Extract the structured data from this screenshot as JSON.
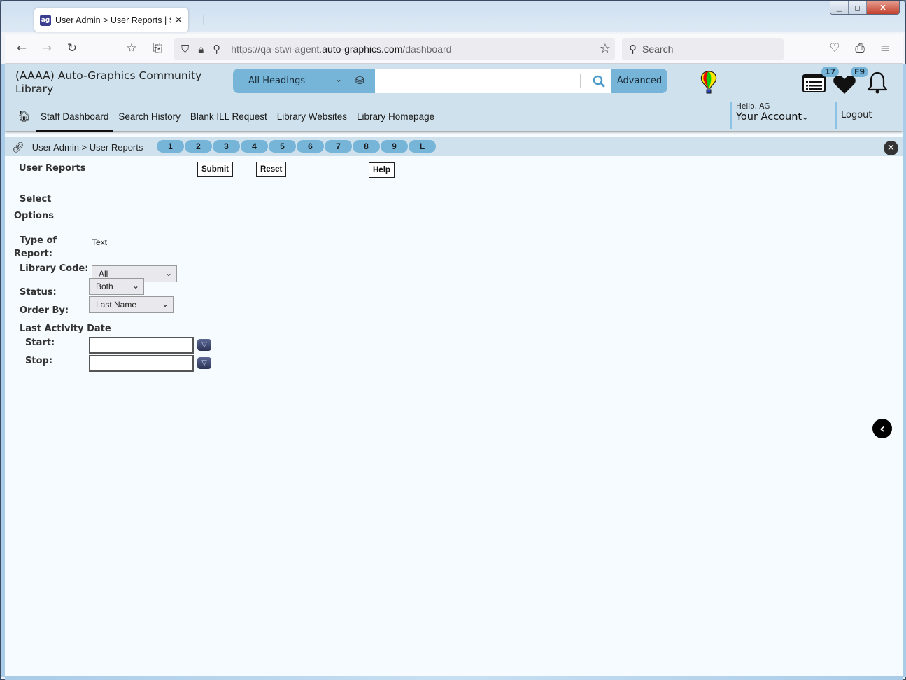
{
  "browser": {
    "tab_title": "User Admin > User Reports | STWI",
    "tab_favicon": "ag-logo-icon",
    "url_prefix": "https://qa-stwi-agent.",
    "url_domain": "auto-graphics.com",
    "url_path": "/dashboard",
    "search_placeholder": "Search",
    "window_controls": {
      "minimize": "▭",
      "maximize": "◻",
      "close": "X"
    }
  },
  "header": {
    "library_name": "(AAAA) Auto-Graphics Community Library",
    "search_scope": "All Headings",
    "search_value": "",
    "advanced_label": "Advanced",
    "list_badge": "17",
    "favorites_badge": "F9"
  },
  "nav": {
    "items": [
      {
        "label": "Staff Dashboard",
        "active": true
      },
      {
        "label": "Search History"
      },
      {
        "label": "Blank ILL Request"
      },
      {
        "label": "Library Websites"
      },
      {
        "label": "Library Homepage"
      }
    ],
    "hello": "Hello, AG",
    "account": "Your Account",
    "logout": "Logout"
  },
  "breadcrumb": {
    "text": "User Admin > User Reports",
    "pills": [
      "1",
      "2",
      "3",
      "4",
      "5",
      "6",
      "7",
      "8",
      "9",
      "L"
    ]
  },
  "form": {
    "title": "User Reports",
    "submit": "Submit",
    "reset": "Reset",
    "help": "Help",
    "select_options_1": "Select",
    "select_options_2": "Options",
    "type_label_1": "Type of",
    "type_label_2": "Report:",
    "type_value": "Text",
    "library_code_label": "Library Code:",
    "library_code_value": "All",
    "status_label": "Status:",
    "status_value": "Both",
    "order_by_label": "Order By:",
    "order_by_value": "Last Name",
    "last_activity_label": "Last Activity Date",
    "start_label": "Start:",
    "start_value": "",
    "stop_label": "Stop:",
    "stop_value": ""
  }
}
